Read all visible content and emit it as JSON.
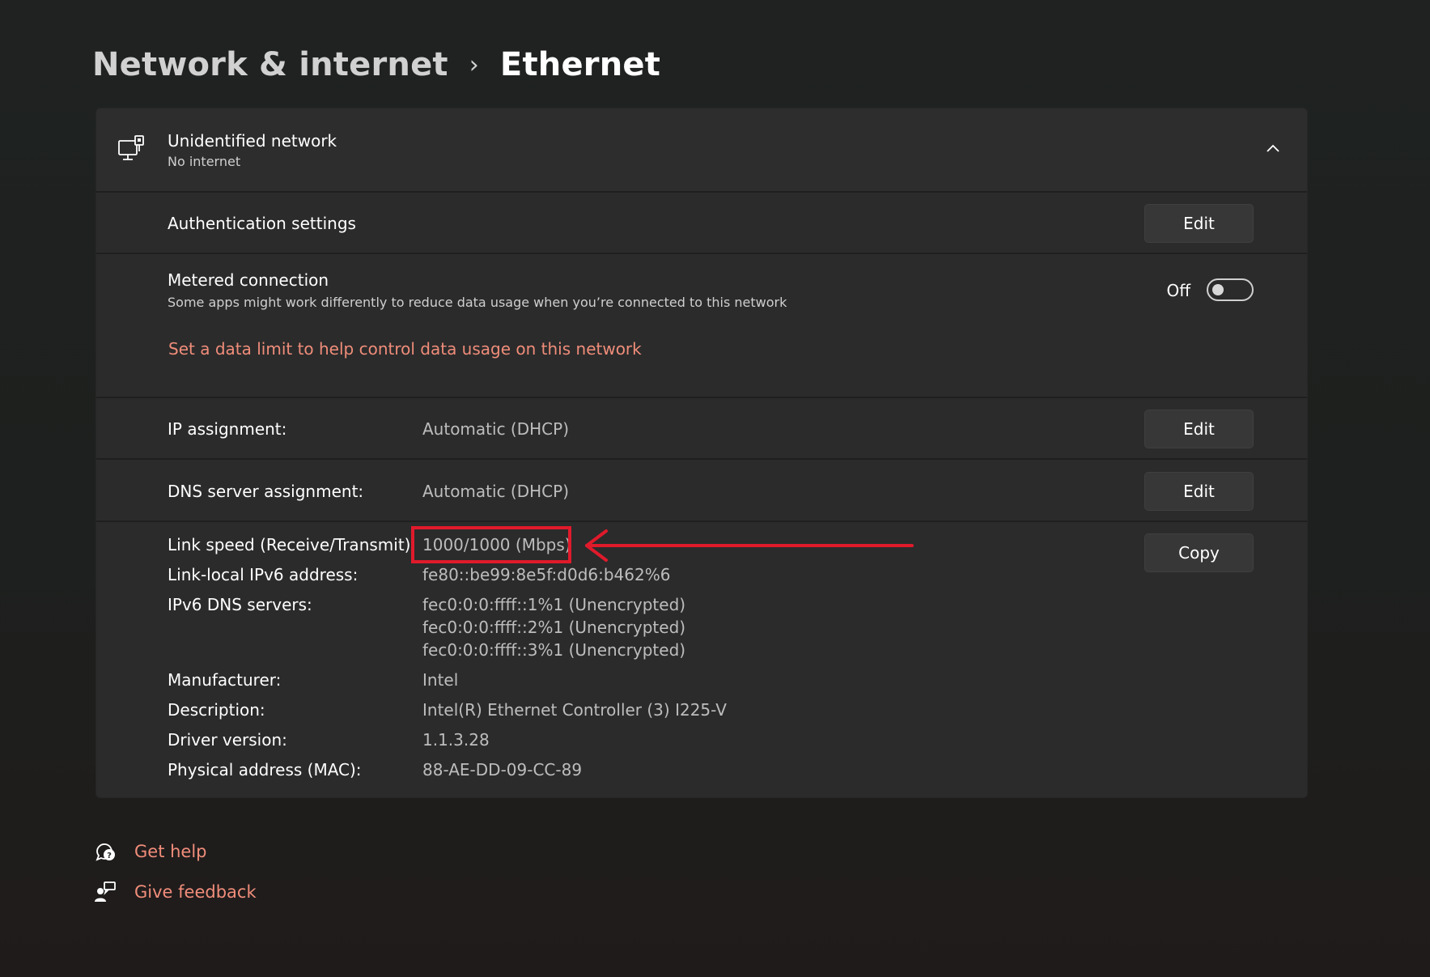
{
  "breadcrumb": {
    "parent": "Network & internet",
    "separator": "›",
    "current": "Ethernet"
  },
  "network": {
    "icon": "ethernet-computer-icon",
    "title": "Unidentified network",
    "subtitle": "No internet",
    "expanded": true
  },
  "auth": {
    "label": "Authentication settings",
    "button": "Edit"
  },
  "metered": {
    "label": "Metered connection",
    "description": "Some apps might work differently to reduce data usage when you’re connected to this network",
    "toggle_label": "Off",
    "toggle_on": false,
    "link": "Set a data limit to help control data usage on this network"
  },
  "ip": {
    "label": "IP assignment:",
    "value": "Automatic (DHCP)",
    "button": "Edit"
  },
  "dns": {
    "label": "DNS server assignment:",
    "value": "Automatic (DHCP)",
    "button": "Edit"
  },
  "properties": {
    "copy_button": "Copy",
    "rows": [
      {
        "label": "Link speed (Receive/Transmit):",
        "values": [
          "1000/1000 (Mbps)"
        ]
      },
      {
        "label": "Link-local IPv6 address:",
        "values": [
          "fe80::be99:8e5f:d0d6:b462%6"
        ]
      },
      {
        "label": "IPv6 DNS servers:",
        "values": [
          "fec0:0:0:ffff::1%1 (Unencrypted)",
          "fec0:0:0:ffff::2%1 (Unencrypted)",
          "fec0:0:0:ffff::3%1 (Unencrypted)"
        ]
      },
      {
        "label": "Manufacturer:",
        "values": [
          "Intel"
        ]
      },
      {
        "label": "Description:",
        "values": [
          "Intel(R) Ethernet Controller (3) I225-V"
        ]
      },
      {
        "label": "Driver version:",
        "values": [
          "1.1.3.28"
        ]
      },
      {
        "label": "Physical address (MAC):",
        "values": [
          "88-AE-DD-09-CC-89"
        ]
      }
    ]
  },
  "annotation": {
    "color": "#e01a2b"
  },
  "footer": {
    "help": "Get help",
    "feedback": "Give feedback"
  },
  "colors": {
    "accent_link": "#f08d7a",
    "card_bg": "#2b2b2b",
    "page_bg": "#1f2220"
  }
}
